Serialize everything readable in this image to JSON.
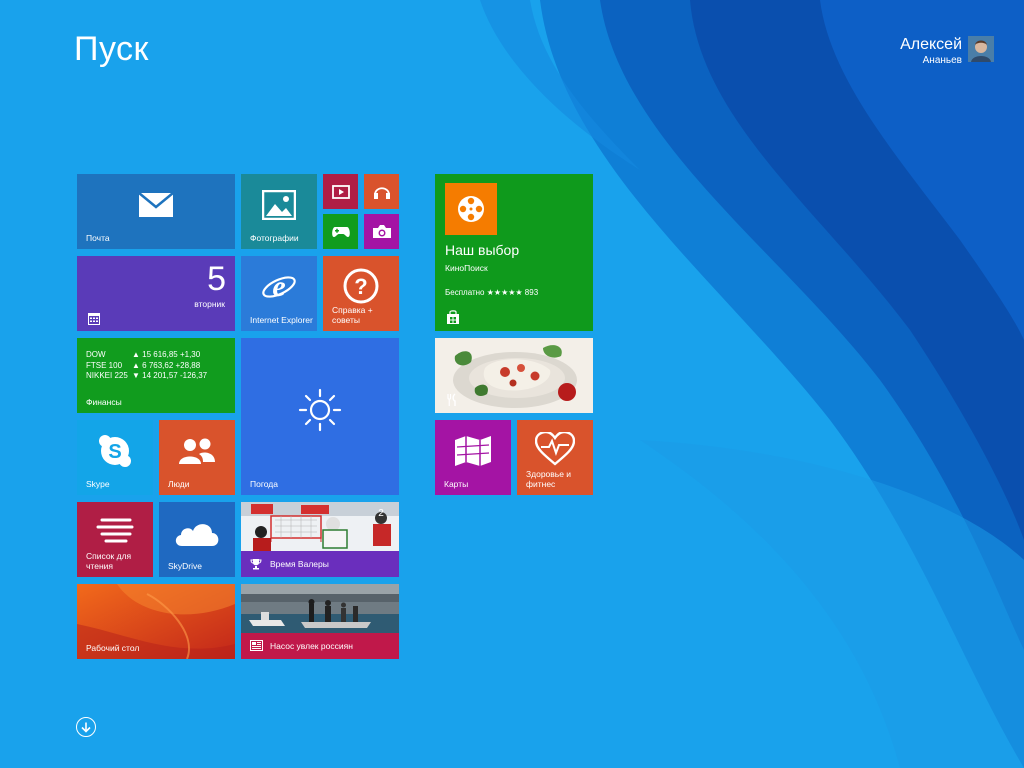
{
  "start": {
    "title": "Пуск"
  },
  "user": {
    "first_name": "Алексей",
    "last_name": "Ананьев"
  },
  "tiles": {
    "mail": {
      "label": "Почта",
      "color": "#1e73be"
    },
    "photos": {
      "label": "Фотографии",
      "color": "#1a8a99"
    },
    "video": {
      "color": "#b01e45"
    },
    "music": {
      "color": "#d9532c"
    },
    "games": {
      "color": "#119c1e"
    },
    "camera": {
      "color": "#a414a4"
    },
    "calendar": {
      "day": "5",
      "weekday": "вторник",
      "color": "#5a3bb8"
    },
    "ie": {
      "label": "Internet Explorer",
      "color": "#2b7bd9"
    },
    "help": {
      "label": "Справка + советы",
      "color": "#d9532c"
    },
    "finance": {
      "label": "Финансы",
      "color": "#119c1e",
      "rows": [
        {
          "name": "DOW",
          "value": "▲ 15 616,85 +1,30"
        },
        {
          "name": "FTSE 100",
          "value": "▲ 6 763,62 +28,88"
        },
        {
          "name": "NIKKEI 225",
          "value": "▼ 14 201,57 -126,37"
        }
      ]
    },
    "weather": {
      "label": "Погода",
      "color": "#2f6ee3"
    },
    "skype": {
      "label": "Skype",
      "color": "#13a5e8"
    },
    "people": {
      "label": "Люди",
      "color": "#d9532c"
    },
    "reading": {
      "label": "Список для чтения",
      "color": "#b01e45"
    },
    "skydrive": {
      "label": "SkyDrive",
      "color": "#1f69c1"
    },
    "sport": {
      "label": "Время Валеры",
      "color": "#6a2ebd"
    },
    "desktop": {
      "label": "Рабочий стол"
    },
    "news": {
      "label": "Насос увлек россиян",
      "color": "#c0184a"
    },
    "store": {
      "heading": "Наш выбор",
      "app": "КиноПоиск",
      "rating": "Бесплатно ★★★★★ 893",
      "color": "#0f9a1c"
    },
    "food": {},
    "maps": {
      "label": "Карты",
      "color": "#a414a4"
    },
    "health": {
      "label": "Здоровье и фитнес",
      "color": "#d9532c"
    }
  }
}
